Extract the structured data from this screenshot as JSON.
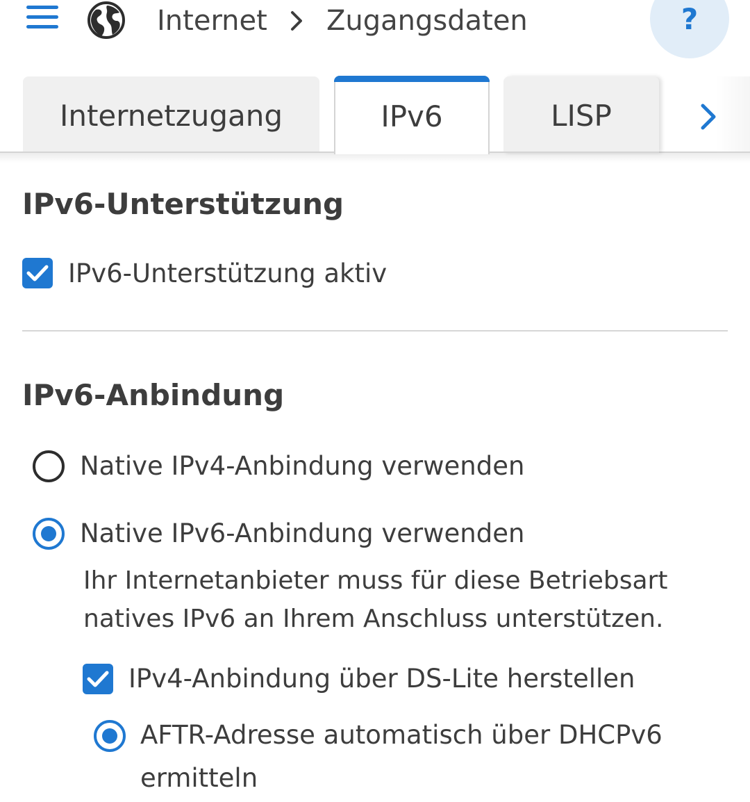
{
  "header": {
    "menu_icon": "hamburger-menu-icon",
    "section_icon": "globe-icon",
    "breadcrumb": [
      "Internet",
      "Zugangsdaten"
    ],
    "help_label": "?"
  },
  "tabs": [
    {
      "label": "Internetzugang",
      "active": false
    },
    {
      "label": "IPv6",
      "active": true
    },
    {
      "label": "LISP",
      "active": false
    }
  ],
  "tabs_more_icon": "chevron-right-icon",
  "colors": {
    "accent": "#1f78d1",
    "help_bg": "#e1edf8",
    "tab_bg": "#f0f0f0",
    "text": "#3d3d3d"
  },
  "support": {
    "title": "IPv6-Unterstützung",
    "checkbox_label": "IPv6-Unterstützung aktiv",
    "checked": true
  },
  "connection": {
    "title": "IPv6-Anbindung",
    "options": [
      {
        "label": "Native IPv4-Anbindung verwenden",
        "selected": false
      },
      {
        "label": "Native IPv6-Anbindung verwenden",
        "selected": true
      }
    ],
    "native_ipv6_description": [
      "Ihr Internetanbieter muss für diese Betriebsart",
      "natives IPv6 an Ihrem Anschluss unterstützen."
    ],
    "ds_lite_checkbox_label": "IPv4-Anbindung über DS-Lite herstellen",
    "ds_lite_checked": true,
    "aftr_option_label": [
      "AFTR-Adresse automatisch über DHCPv6",
      "ermitteln"
    ],
    "aftr_selected": true
  }
}
